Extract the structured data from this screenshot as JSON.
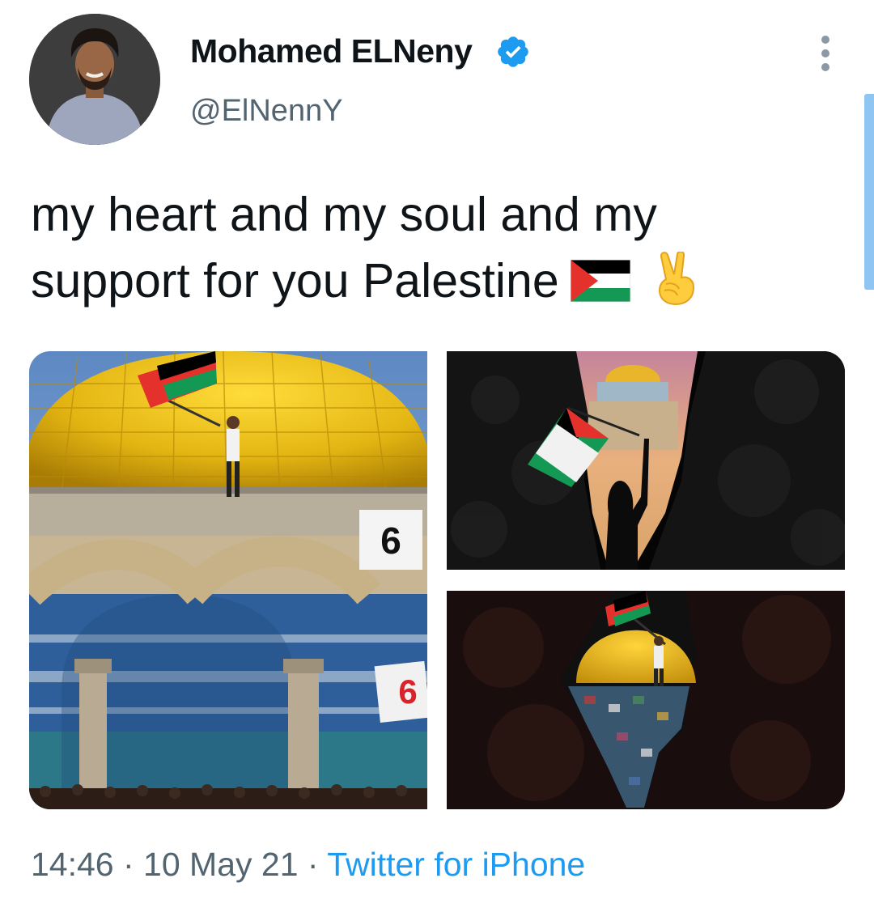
{
  "author": {
    "name": "Mohamed ELNeny",
    "handle": "@ElNennY",
    "verified": true,
    "avatar_icon": "avatar-photo"
  },
  "tweet": {
    "text_line1": "my heart and my soul and my",
    "text_line2": "support for you  Palestine",
    "emoji_flag": "palestine-flag-emoji",
    "emoji_hand": "victory-hand-emoji"
  },
  "media": [
    {
      "icon": "dome-of-the-rock-photo"
    },
    {
      "icon": "flag-silhouette-cave-photo"
    },
    {
      "icon": "palestine-map-dome-photo"
    }
  ],
  "meta": {
    "time": "14:46",
    "sep1": " · ",
    "date": "10 May 21",
    "sep2": " · ",
    "source": "Twitter for iPhone"
  },
  "colors": {
    "accent": "#1d9bf0",
    "secondary_text": "#536471",
    "primary_text": "#0f1419",
    "flag_red": "#e4312b",
    "flag_green": "#149954",
    "flag_black": "#000000"
  }
}
